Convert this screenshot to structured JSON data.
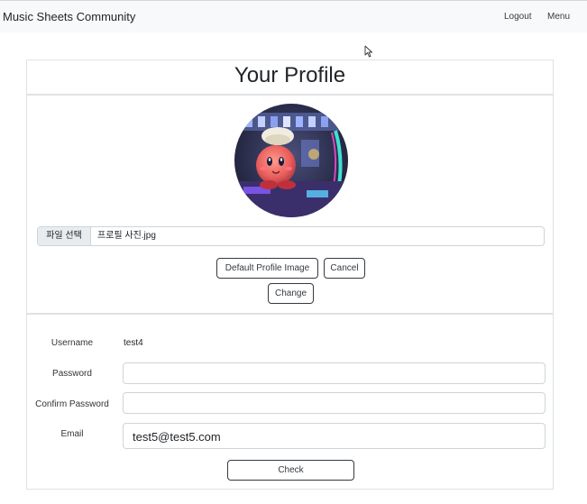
{
  "navbar": {
    "brand": "Music Sheets Community",
    "logout": "Logout",
    "menu": "Menu"
  },
  "profile": {
    "title": "Your Profile",
    "file_button": "파일 선택",
    "file_name": "프로필 사진.jpg",
    "default_image_button": "Default Profile Image",
    "cancel_button": "Cancel",
    "change_button": "Change"
  },
  "form": {
    "username_label": "Username",
    "username_value": "test4",
    "password_label": "Password",
    "password_value": "",
    "confirm_label": "Confirm Password",
    "confirm_value": "",
    "email_label": "Email",
    "email_value": "test5@test5.com",
    "check_button": "Check"
  },
  "icons": {
    "cursor": "mouse-pointer-icon"
  }
}
